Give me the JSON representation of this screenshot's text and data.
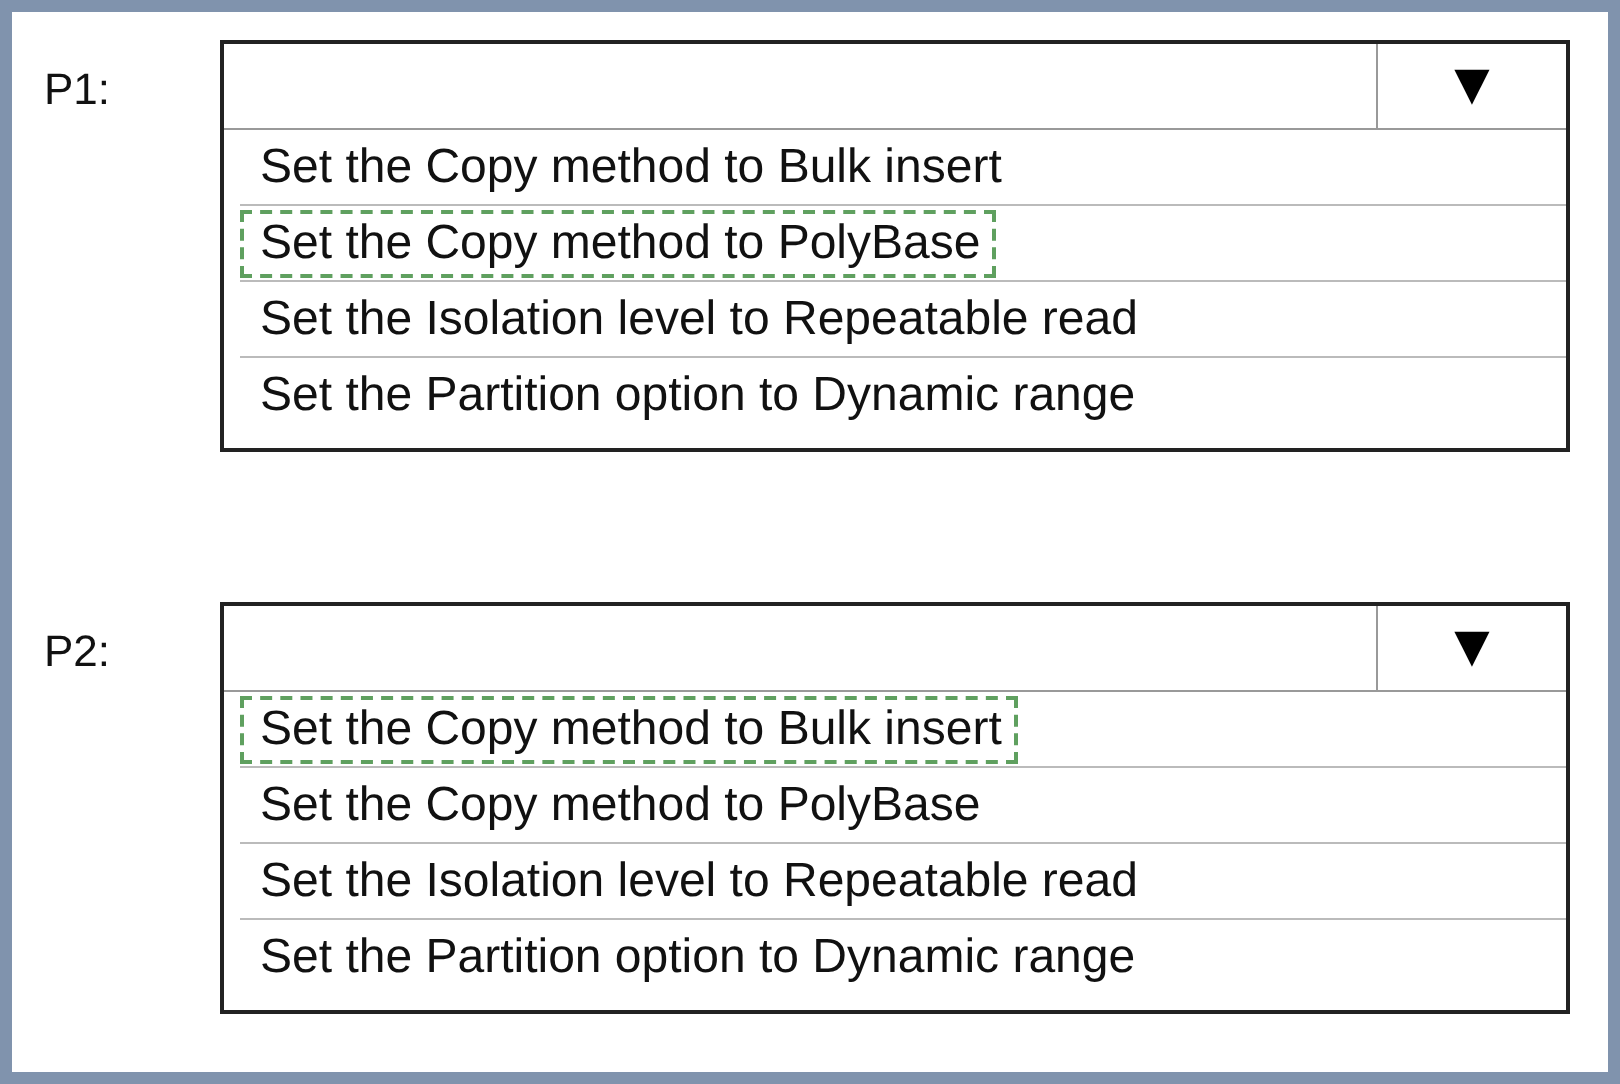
{
  "groups": [
    {
      "label": "P1:",
      "arrow": "▼",
      "options": [
        {
          "text": "Set the Copy method to Bulk insert",
          "selected": false
        },
        {
          "text": "Set the Copy method to PolyBase",
          "selected": true
        },
        {
          "text": "Set the Isolation level to Repeatable read",
          "selected": false
        },
        {
          "text": "Set the Partition option to Dynamic range",
          "selected": false
        }
      ]
    },
    {
      "label": "P2:",
      "arrow": "▼",
      "options": [
        {
          "text": "Set the Copy method to Bulk insert",
          "selected": true
        },
        {
          "text": "Set the Copy method to PolyBase",
          "selected": false
        },
        {
          "text": "Set the Isolation level to Repeatable read",
          "selected": false
        },
        {
          "text": "Set the Partition option to Dynamic range",
          "selected": false
        }
      ]
    }
  ]
}
